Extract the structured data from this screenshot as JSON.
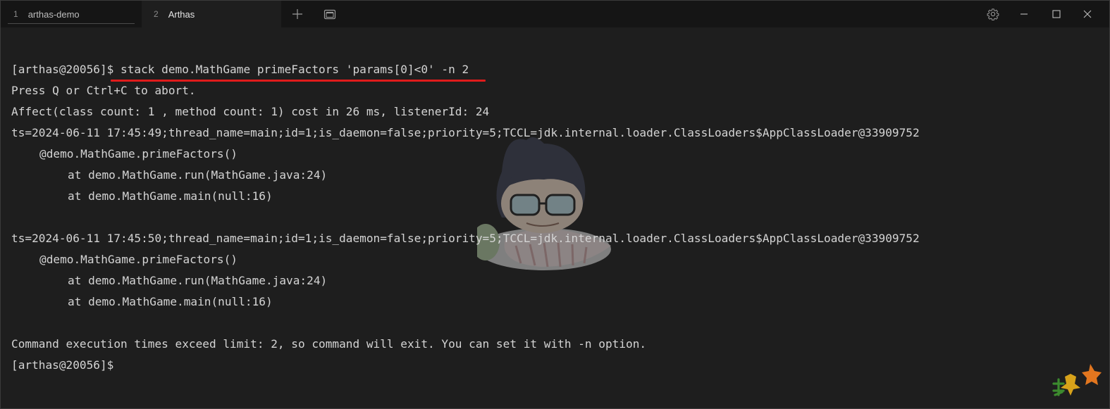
{
  "titlebar": {
    "tabs": [
      {
        "number": "1",
        "label": "arthas-demo"
      },
      {
        "number": "2",
        "label": "Arthas"
      }
    ],
    "icons": {
      "new_tab": "plus-icon",
      "new_window": "window-icon",
      "settings": "gear-icon",
      "minimize": "minimize-icon",
      "maximize": "maximize-icon",
      "close": "close-icon"
    }
  },
  "terminal": {
    "prompt": "[arthas@20056]$",
    "command": " stack demo.MathGame primeFactors 'params[0]<0' -n 2",
    "lines": {
      "abort": "Press Q or Ctrl+C to abort.",
      "affect": "Affect(class count: 1 , method count: 1) cost in 26 ms, listenerId: 24",
      "ts1": "ts=2024-06-11 17:45:49;thread_name=main;id=1;is_daemon=false;priority=5;TCCL=jdk.internal.loader.ClassLoaders$AppClassLoader@33909752",
      "method1": "@demo.MathGame.primeFactors()",
      "frame1a": "at demo.MathGame.run(MathGame.java:24)",
      "frame1b": "at demo.MathGame.main(null:16)",
      "ts2": "ts=2024-06-11 17:45:50;thread_name=main;id=1;is_daemon=false;priority=5;TCCL=jdk.internal.loader.ClassLoaders$AppClassLoader@33909752",
      "method2": "@demo.MathGame.primeFactors()",
      "frame2a": "at demo.MathGame.run(MathGame.java:24)",
      "frame2b": "at demo.MathGame.main(null:16)",
      "exit": "Command execution times exceed limit: 2, so command will exit. You can set it with -n option.",
      "final_prompt": "[arthas@20056]$"
    },
    "highlight_color": "#e01b1b"
  },
  "colors": {
    "background": "#1e1e1e",
    "titlebar": "#151515",
    "text": "#d4d4d4"
  }
}
